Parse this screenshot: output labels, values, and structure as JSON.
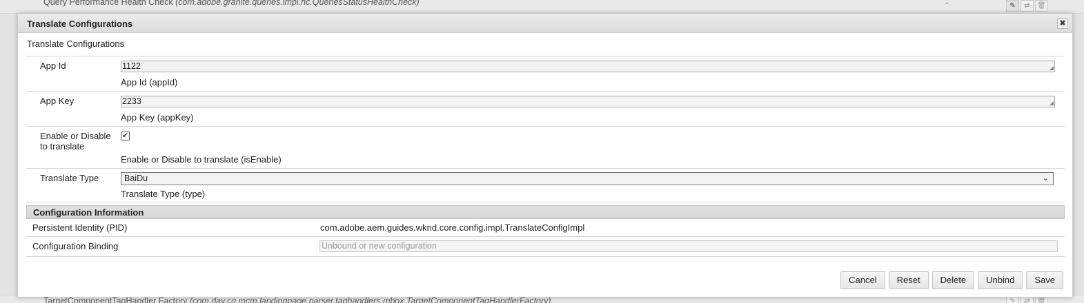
{
  "background": {
    "top_row": {
      "name": "Query Performance Health Check",
      "pid": "(com.adobe.granite.queries.impl.hc.QueriesStatusHealthCheck)",
      "status": "-"
    },
    "bottom_row": {
      "name": "TargetComponentTagHandler Factory",
      "pid": "(com.day.cq.mcm.landingpage.parser.taghandlers.mbox.TargetComponentTagHandlerFactory)"
    }
  },
  "dialog": {
    "title": "Translate Configurations",
    "close_glyph": "✖",
    "subtitle": "Translate Configurations",
    "fields": {
      "app_id": {
        "label": "App Id",
        "value": "1122",
        "description": "App Id (appId)"
      },
      "app_key": {
        "label": "App Key",
        "value": "2233",
        "description": "App Key (appKey)"
      },
      "is_enable": {
        "label": "Enable or Disable to translate",
        "checked": true,
        "description": "Enable or Disable to translate (isEnable)"
      },
      "type": {
        "label": "Translate Type",
        "selected": "BaiDu",
        "description": "Translate Type (type)"
      }
    },
    "config_info": {
      "header": "Configuration Information",
      "pid_label": "Persistent Identity (PID)",
      "pid_value": "com.adobe.aem.guides.wknd.core.config.impl.TranslateConfigImpl",
      "binding_label": "Configuration Binding",
      "binding_placeholder": "Unbound or new configuration"
    },
    "buttons": {
      "cancel": "Cancel",
      "reset": "Reset",
      "delete": "Delete",
      "unbind": "Unbind",
      "save": "Save"
    }
  }
}
